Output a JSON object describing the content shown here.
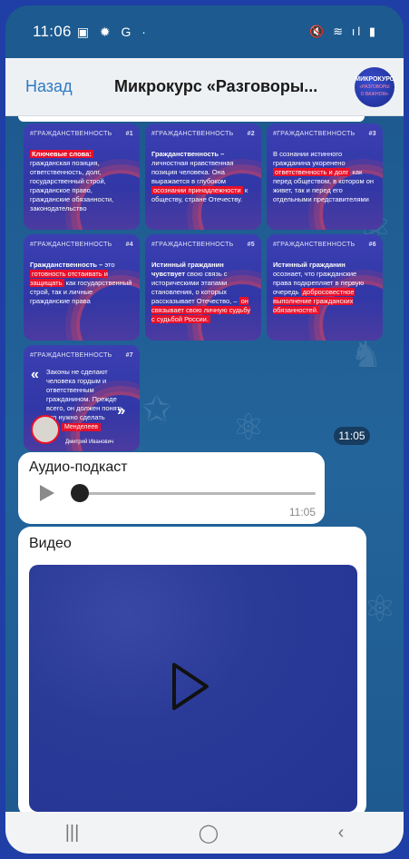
{
  "status_bar": {
    "time": "11:06",
    "status_icons": "▣ ✹ G ·",
    "system_icons": "🔇 ≋ ıl ▮"
  },
  "header": {
    "back_label": "Назад",
    "title": "Микрокурс «Разговоры...",
    "avatar_line1": "МИКРОКУРС",
    "avatar_line2": "«РАЗГОВОРЫ",
    "avatar_line3": "О ВАЖНОМ»"
  },
  "cards": [
    {
      "tag": "#ГРАЖДАНСТВЕННОСТЬ",
      "num": "#1",
      "highlight": "Ключевые слова:",
      "text": "гражданская позиция, ответственность, долг, государственный строй, гражданское право, гражданские обязанности, законодательство"
    },
    {
      "tag": "#ГРАЖДАНСТВЕННОСТЬ",
      "num": "#2",
      "bold": "Гражданственность –",
      "text": "личностная нравственная позиция человека. Она выражается в глубоком",
      "highlight": "осознании принадлежности",
      "text2": "к обществу, стране Отечеству."
    },
    {
      "tag": "#ГРАЖДАНСТВЕННОСТЬ",
      "num": "#3",
      "text": "В сознании истинного гражданина укоренено",
      "highlight": "ответственность и долг",
      "text2": "как перед обществом, в котором он живет, так и перед его отдельными представителями"
    },
    {
      "tag": "#ГРАЖДАНСТВЕННОСТЬ",
      "num": "#4",
      "bold": "Гражданственность –",
      "text": "это",
      "highlight": "готовность отстаивать и защищать",
      "text2": "как государственный строй, так и личные гражданские права"
    },
    {
      "tag": "#ГРАЖДАНСТВЕННОСТЬ",
      "num": "#5",
      "bold": "Истинный гражданин чувствует",
      "text": "свою связь с историческими этапами становления, о которых рассказывает Отечество, –",
      "highlight": "он связывает свою личную судьбу с судьбой России."
    },
    {
      "tag": "#ГРАЖДАНСТВЕННОСТЬ",
      "num": "#6",
      "bold": "Истинный гражданин",
      "text": "осознает, что гражданские права подкрепляет в первую очередь",
      "highlight": "добросовестное выполнение гражданских обязанностей."
    },
    {
      "tag": "#ГРАЖДАНСТВЕННОСТЬ",
      "num": "#7",
      "text": "Законы не сделают человека гордым и ответственным гражданином. Прежде всего, он должен понять, что нужно сделать",
      "person_name": "Менделеев",
      "person_desc": "Дмитрий Иванович"
    }
  ],
  "gallery_time": "11:05",
  "audio": {
    "label": "Аудио-подкаст",
    "time": "11:05"
  },
  "video": {
    "label": "Видео"
  },
  "navbar": {
    "recents": "|||",
    "home": "◯",
    "back": "‹"
  }
}
